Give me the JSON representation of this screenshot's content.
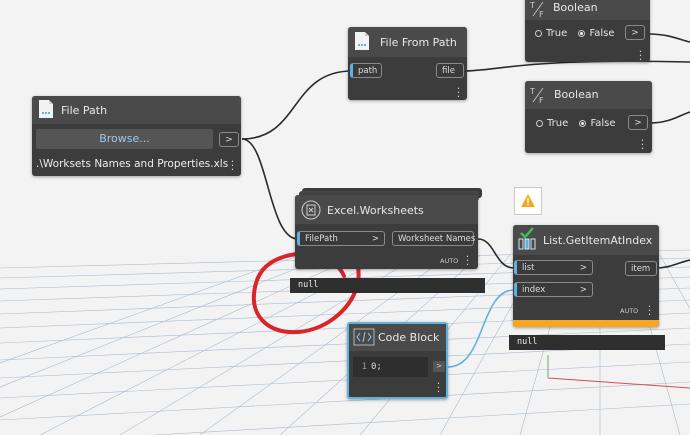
{
  "colors": {
    "node_body": "#3c3c3c",
    "wire": "#2b2b2b",
    "wire_blue": "#5fb2e0",
    "warning": "#f2a81d",
    "orange_bar": "#f5a623",
    "annotation": "#d9242a"
  },
  "file_path": {
    "title": "File Path",
    "browse": "Browse...",
    "output": ">",
    "value": ".\\Worksets Names and Properties.xls"
  },
  "file_from_path": {
    "title": "File From Path",
    "input": "path",
    "output": "file"
  },
  "boolean_top": {
    "title": "Boolean",
    "true_label": "True",
    "false_label": "False",
    "output": ">"
  },
  "boolean_mid": {
    "title": "Boolean",
    "true_label": "True",
    "false_label": "False",
    "output": ">"
  },
  "excel_worksheets": {
    "title": "Excel.Worksheets",
    "input": "FilePath",
    "input_arrow": ">",
    "output": "Worksheet Names",
    "lacing": "AUTO",
    "preview": "null"
  },
  "get_item": {
    "title": "List.GetItemAtIndex",
    "input_list": "list",
    "input_index": "index",
    "arrow": ">",
    "output": "item",
    "lacing": "AUTO",
    "preview": "null"
  },
  "code_block": {
    "title": "Code Block",
    "line_no": "1",
    "code": "0;",
    "output": ">"
  }
}
